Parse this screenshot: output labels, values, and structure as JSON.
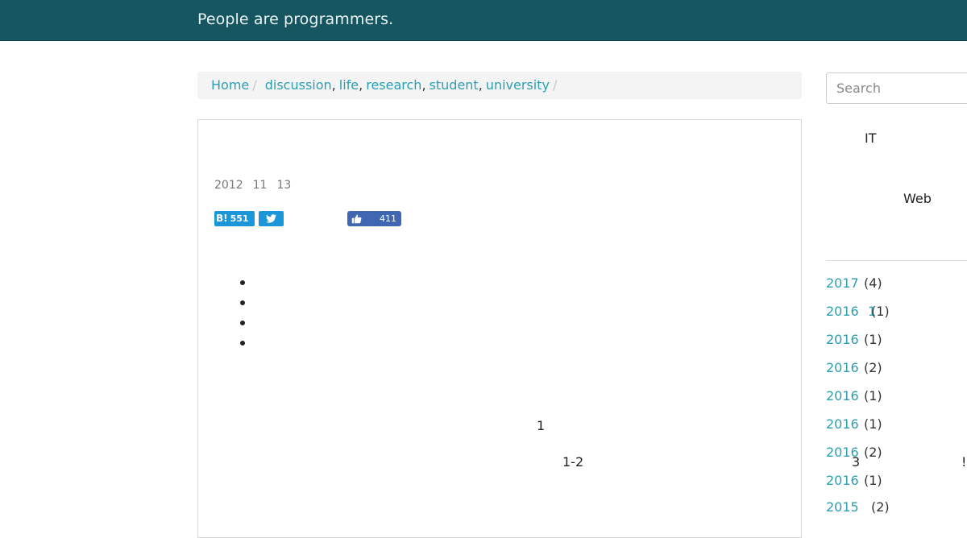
{
  "header": {
    "brand": "People are programmers."
  },
  "breadcrumb": {
    "home": "Home",
    "separator": "/",
    "tags": [
      "discussion",
      "life",
      "research",
      "student",
      "university"
    ],
    "tag_separator": ","
  },
  "post": {
    "date": {
      "year": "2012",
      "month": "11",
      "day": "13"
    },
    "share": {
      "hatena_count": "551",
      "hatena_icon": "hatena-bookmark-icon",
      "twitter_icon": "twitter-bird-icon",
      "facebook_icon": "thumbs-up-icon",
      "facebook_count": "411"
    },
    "fragments": {
      "a": "1",
      "b": "1-2"
    }
  },
  "sidebar": {
    "search_placeholder": "Search",
    "text_it": "IT",
    "text_web": "Web",
    "text_3": "3",
    "text_excl": "!!",
    "archives": [
      {
        "year": "2017",
        "month": "",
        "count": "(4)"
      },
      {
        "year": "2016",
        "month": "1",
        "count": "(1)"
      },
      {
        "year": "2016",
        "month": "",
        "count": "(1)"
      },
      {
        "year": "2016",
        "month": "",
        "count": "(2)"
      },
      {
        "year": "2016",
        "month": "",
        "count": "(1)"
      },
      {
        "year": "2016",
        "month": "",
        "count": "(1)"
      },
      {
        "year": "2016",
        "month": "",
        "count": "(2)"
      },
      {
        "year": "2016",
        "month": "",
        "count": "(1)"
      },
      {
        "year": "2015",
        "month": "",
        "count": "(2)"
      }
    ]
  },
  "colors": {
    "header_bg": "#165660",
    "link": "#2a9fb2",
    "hatena": "#1b96d8",
    "facebook": "#4267b2"
  }
}
